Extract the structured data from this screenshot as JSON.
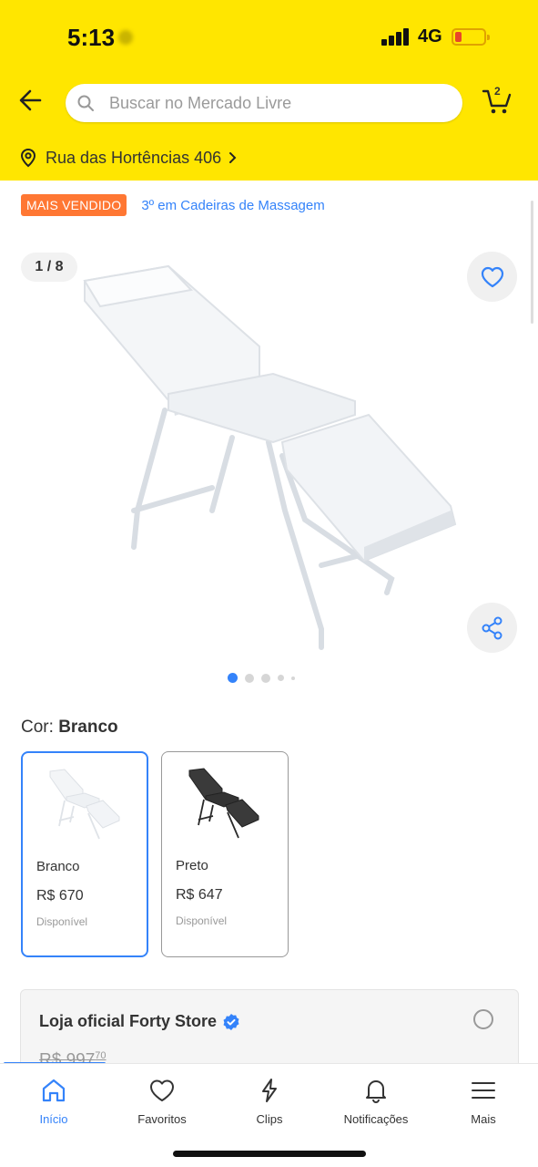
{
  "status_bar": {
    "time": "5:13",
    "network": "4G"
  },
  "header": {
    "search_placeholder": "Buscar no Mercado Livre",
    "cart_count": "2",
    "address": "Rua das Hortências 406"
  },
  "product": {
    "badge": "MAIS VENDIDO",
    "ranking_link": "3º em Cadeiras de Massagem",
    "image_counter": "1 / 8",
    "color_label": "Cor:",
    "color_value": "Branco",
    "variants": [
      {
        "name": "Branco",
        "price": "R$ 670",
        "status": "Disponível",
        "selected": true
      },
      {
        "name": "Preto",
        "price": "R$ 647",
        "status": "Disponível",
        "selected": false
      }
    ]
  },
  "store_card": {
    "name": "Loja oficial Forty Store",
    "old_price": "R$ 997",
    "old_price_cents": "70"
  },
  "tabs": [
    {
      "label": "Início",
      "icon": "home-icon",
      "active": true
    },
    {
      "label": "Favoritos",
      "icon": "heart-icon",
      "active": false
    },
    {
      "label": "Clips",
      "icon": "bolt-icon",
      "active": false
    },
    {
      "label": "Notificações",
      "icon": "bell-icon",
      "active": false
    },
    {
      "label": "Mais",
      "icon": "menu-icon",
      "active": false
    }
  ],
  "colors": {
    "brand_yellow": "#ffe600",
    "accent_blue": "#3483fa",
    "badge_orange": "#ff7733"
  }
}
